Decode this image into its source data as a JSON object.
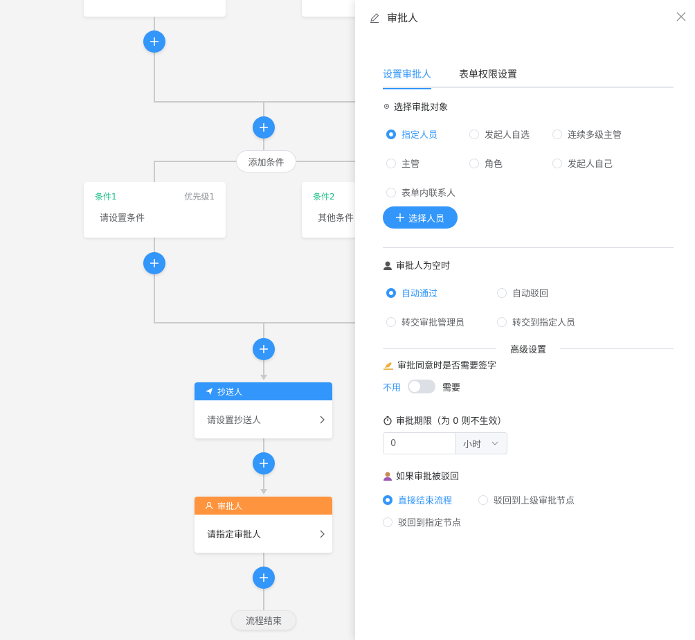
{
  "canvas": {
    "add_condition_label": "添加条件",
    "conditions": [
      {
        "name": "条件1",
        "priority": "优先级1",
        "body": "请设置条件"
      },
      {
        "name": "条件2",
        "priority": "",
        "body": "其他条件"
      }
    ],
    "cc_node": {
      "title": "抄送人",
      "body": "请设置抄送人",
      "color": "#3296fa"
    },
    "approver_node": {
      "title": "审批人",
      "body": "请指定审批人",
      "color": "#ff943e"
    },
    "end_label": "流程结束"
  },
  "drawer": {
    "title": "审批人",
    "tabs": [
      {
        "label": "设置审批人",
        "active": true
      },
      {
        "label": "表单权限设置",
        "active": false
      }
    ],
    "select_target": {
      "title": "选择审批对象",
      "options": [
        "指定人员",
        "发起人自选",
        "连续多级主管",
        "主管",
        "角色",
        "发起人自己",
        "表单内联系人"
      ],
      "selected": "指定人员",
      "button_label": "选择人员"
    },
    "empty_approver": {
      "title": "审批人为空时",
      "options": [
        "自动通过",
        "自动驳回",
        "转交审批管理员",
        "转交到指定人员"
      ],
      "selected": "自动通过"
    },
    "advanced_label": "高级设置",
    "signature": {
      "title": "审批同意时是否需要签字",
      "off_label": "不用",
      "on_label": "需要",
      "enabled": false
    },
    "deadline": {
      "title": "审批期限（为 0 则不生效）",
      "value": "0",
      "unit": "小时"
    },
    "rejected": {
      "title": "如果审批被驳回",
      "options": [
        "直接结束流程",
        "驳回到上级审批节点",
        "驳回到指定节点"
      ],
      "selected": "直接结束流程"
    },
    "accent_color": "#3296fa"
  }
}
